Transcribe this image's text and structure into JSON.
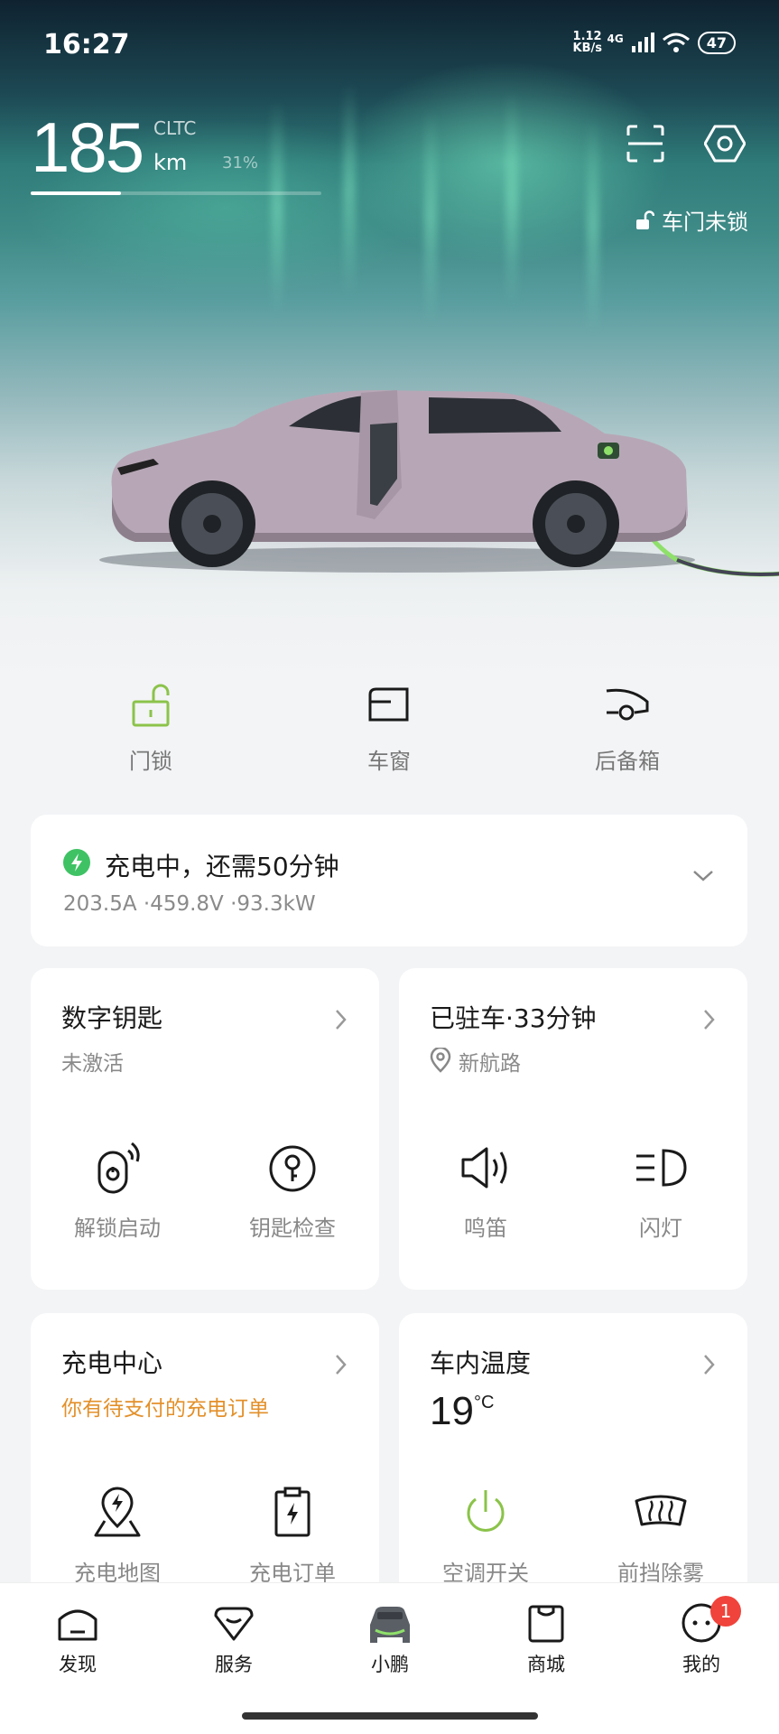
{
  "status_bar": {
    "time": "16:27",
    "net_speed": "1.12\nKB/s",
    "net_speed_top": "1.12",
    "net_speed_bottom": "KB/s",
    "net_type": "4G",
    "battery": "47"
  },
  "range": {
    "value": "185",
    "standard": "CLTC",
    "unit": "km",
    "percent_label": "31%",
    "percent": 31
  },
  "header_icons": [
    "scan-icon",
    "settings-icon"
  ],
  "lock_status": "车门未锁",
  "quick_actions": [
    {
      "label": "门锁",
      "icon": "unlock-icon",
      "color": "#8bc34a"
    },
    {
      "label": "车窗",
      "icon": "window-icon"
    },
    {
      "label": "后备箱",
      "icon": "trunk-icon"
    }
  ],
  "charging": {
    "title": "充电中，还需50分钟",
    "details": "203.5A ·459.8V ·93.3kW"
  },
  "digital_key": {
    "title": "数字钥匙",
    "status": "未激活",
    "buttons": [
      {
        "label": "解锁启动",
        "icon": "key-fob-icon"
      },
      {
        "label": "钥匙检查",
        "icon": "key-check-icon"
      }
    ]
  },
  "parking": {
    "title": "已驻车·33分钟",
    "location": "新航路",
    "buttons": [
      {
        "label": "鸣笛",
        "icon": "horn-icon"
      },
      {
        "label": "闪灯",
        "icon": "headlight-icon"
      }
    ]
  },
  "charge_center": {
    "title": "充电中心",
    "notice": "你有待支付的充电订单",
    "buttons": [
      {
        "label": "充电地图",
        "icon": "charge-map-icon"
      },
      {
        "label": "充电订单",
        "icon": "charge-order-icon"
      }
    ]
  },
  "cabin_temp": {
    "title": "车内温度",
    "value": "19",
    "unit": "°C",
    "buttons": [
      {
        "label": "空调开关",
        "icon": "power-icon",
        "color": "#8bc34a"
      },
      {
        "label": "前挡除雾",
        "icon": "defrost-icon"
      }
    ]
  },
  "bottom_nav": [
    {
      "label": "发现",
      "icon": "discover-icon"
    },
    {
      "label": "服务",
      "icon": "service-icon"
    },
    {
      "label": "小鹏",
      "icon": "car-icon",
      "active": true
    },
    {
      "label": "商城",
      "icon": "mall-icon"
    },
    {
      "label": "我的",
      "icon": "profile-icon",
      "badge": "1"
    }
  ],
  "colors": {
    "accent_green": "#8bc34a",
    "charging_green": "#3fc264",
    "warning_orange": "#e3902a",
    "badge_red": "#f0433b"
  }
}
